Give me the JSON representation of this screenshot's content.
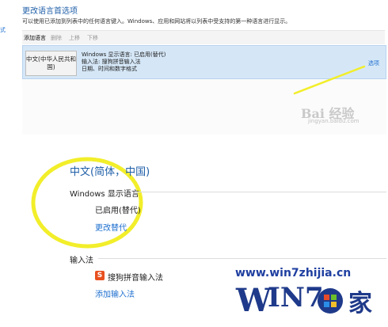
{
  "top": {
    "title": "更改语言首选项",
    "description": "可以使用已添加到列表中的任何语言键入。Windows、应用和网站将以列表中受支持的第一种语言进行显示。",
    "left_edge": "式"
  },
  "toolbar": {
    "add": "添加语言",
    "remove": "删除",
    "move_up": "上移",
    "move_down": "下移"
  },
  "language_row": {
    "tile": "中文(中华人民共和国)",
    "detail_1": "Windows 显示语言: 已启用(替代)",
    "detail_2": "输入法: 搜狗拼音输入法",
    "detail_3": "日期、时间和数字格式",
    "options": "选项"
  },
  "watermark": {
    "main": "Bai 经验",
    "sub": "jingyan.baidu.com"
  },
  "detail": {
    "heading": "中文(简体，中国)",
    "display_section": "Windows 显示语言",
    "status": "已启用(替代)",
    "change_link": "更改替代",
    "ime_section": "输入法",
    "ime_icon_letter": "S",
    "ime_name": "搜狗拼音输入法",
    "add_ime": "添加输入法"
  },
  "branding": {
    "url": "www.win7zhijia.cn",
    "logo_w": "W",
    "logo_in7": "IN7.",
    "logo_char": "家"
  },
  "colors": {
    "link_blue": "#1e6fcf",
    "highlight_row": "#d5e7f7",
    "annotation_yellow": "#f2ee2a",
    "ime_icon": "#e8501f"
  }
}
